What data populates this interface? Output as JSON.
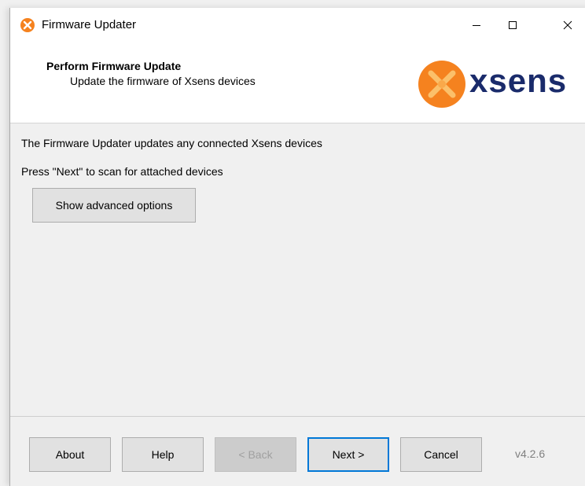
{
  "window": {
    "title": "Firmware Updater"
  },
  "titlebar_buttons": {
    "minimize": "—",
    "maximize": "☐",
    "close": "✕"
  },
  "header": {
    "title": "Perform Firmware Update",
    "subtitle": "Update the firmware of Xsens devices",
    "logo_text": "xsens"
  },
  "content": {
    "line1": "The Firmware Updater updates any connected Xsens devices",
    "line2": "Press \"Next\" to scan for attached devices",
    "advanced_button": "Show advanced options"
  },
  "footer": {
    "about": "About",
    "help": "Help",
    "back": "< Back",
    "next": "Next >",
    "cancel": "Cancel",
    "version": "v4.2.6"
  },
  "colors": {
    "logo_orange": "#f5821f",
    "logo_navy": "#1a2b6b",
    "accent_blue": "#0078d7"
  }
}
